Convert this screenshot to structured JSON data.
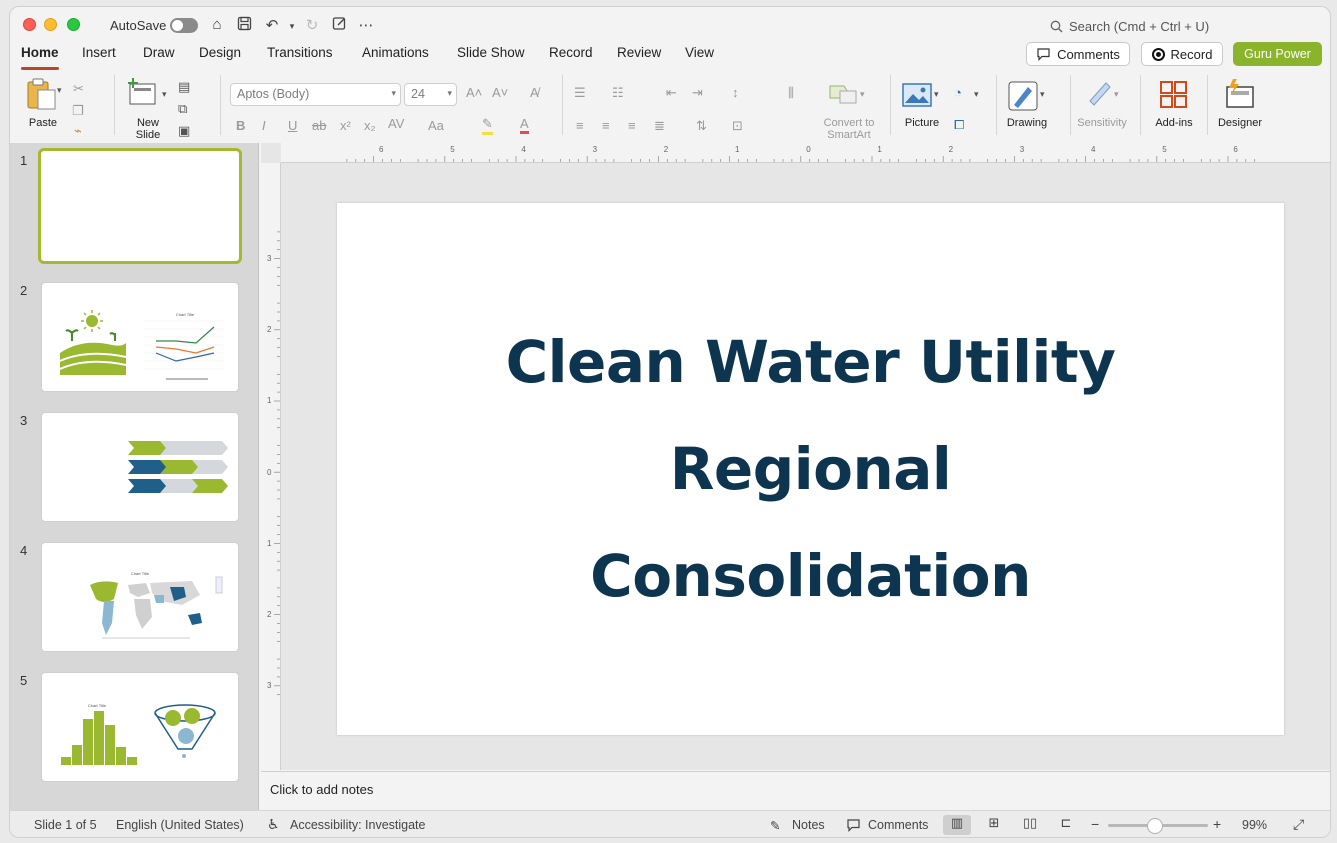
{
  "titlebar": {
    "autosave_label": "AutoSave",
    "search_placeholder": "Search (Cmd + Ctrl + U)"
  },
  "tabs": [
    {
      "label": "Home"
    },
    {
      "label": "Insert"
    },
    {
      "label": "Draw"
    },
    {
      "label": "Design"
    },
    {
      "label": "Transitions"
    },
    {
      "label": "Animations"
    },
    {
      "label": "Slide Show"
    },
    {
      "label": "Record"
    },
    {
      "label": "Review"
    },
    {
      "label": "View"
    }
  ],
  "actions": {
    "comments": "Comments",
    "record": "Record",
    "guru": "Guru Power"
  },
  "ribbon": {
    "paste": "Paste",
    "new_slide_1": "New",
    "new_slide_2": "Slide",
    "font_name": "Aptos (Body)",
    "font_size": "24",
    "convert_1": "Convert to",
    "convert_2": "SmartArt",
    "picture": "Picture",
    "drawing": "Drawing",
    "sensitivity": "Sensitivity",
    "addins": "Add-ins",
    "designer": "Designer"
  },
  "thumbnails": [
    {
      "num": "1"
    },
    {
      "num": "2"
    },
    {
      "num": "3"
    },
    {
      "num": "4"
    },
    {
      "num": "5"
    }
  ],
  "thumb_text": {
    "chart_title": "Chart Title"
  },
  "slide": {
    "title_line1": "Clean Water Utility",
    "title_line2": "Regional",
    "title_line3": "Consolidation"
  },
  "notes": {
    "placeholder": "Click to add notes"
  },
  "status": {
    "slide_count": "Slide 1 of 5",
    "language": "English (United States)",
    "accessibility": "Accessibility: Investigate",
    "notes": "Notes",
    "comments": "Comments",
    "zoom": "99%"
  },
  "ruler": {
    "h": [
      "6",
      "5",
      "4",
      "3",
      "2",
      "1",
      "0",
      "1",
      "2",
      "3",
      "4",
      "5",
      "6"
    ],
    "v": [
      "3",
      "2",
      "1",
      "0",
      "1",
      "2",
      "3"
    ]
  },
  "colors": {
    "accent_green": "#8ab42c",
    "title_navy": "#0d3550",
    "tab_underline": "#b7472a"
  }
}
